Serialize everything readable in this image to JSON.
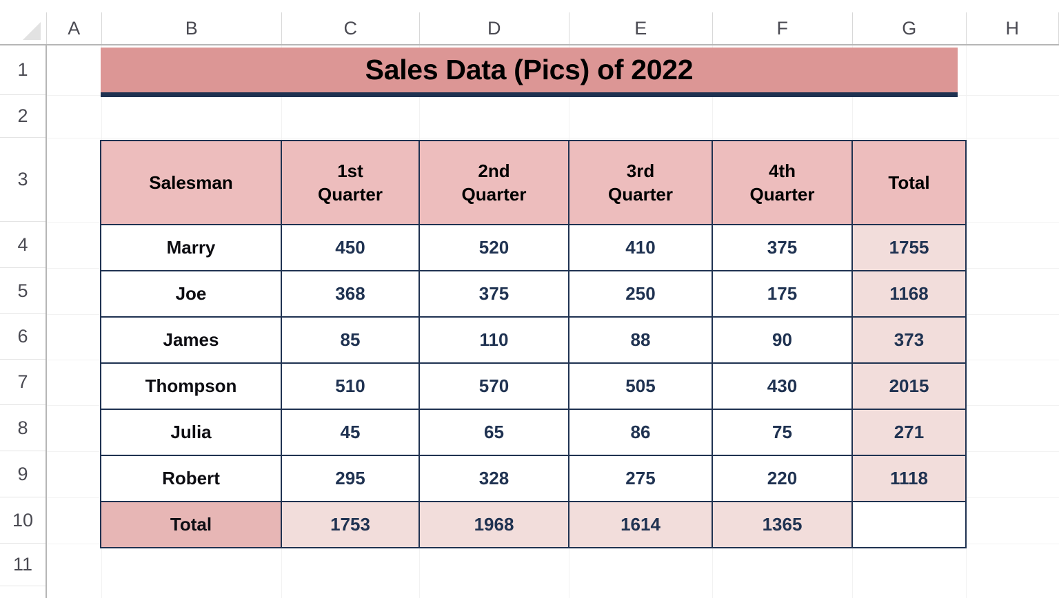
{
  "app": {
    "type": "spreadsheet",
    "colors": {
      "title_fill": "#DC9695",
      "title_underline": "#1F3251",
      "header_fill": "#EDBDBD",
      "total_column_fill": "#F2DDDB",
      "total_row_label_fill": "#E7B6B5",
      "border": "#1F3251",
      "data_text": "#1F3251",
      "gridline": "#F2F2F2",
      "header_strip_text": "#4A4A52"
    }
  },
  "column_headers": [
    "A",
    "B",
    "C",
    "D",
    "E",
    "F",
    "G",
    "H"
  ],
  "row_headers": [
    "1",
    "2",
    "3",
    "4",
    "5",
    "6",
    "7",
    "8",
    "9",
    "10",
    "11"
  ],
  "corner": {
    "icon": "select-all-triangle-icon"
  },
  "title": {
    "text": "Sales Data (Pics) of 2022",
    "merged_range": "B1:G1"
  },
  "table": {
    "headers": [
      {
        "lines": [
          "Salesman"
        ]
      },
      {
        "lines": [
          "1st",
          "Quarter"
        ]
      },
      {
        "lines": [
          "2nd",
          "Quarter"
        ]
      },
      {
        "lines": [
          "3rd",
          "Quarter"
        ]
      },
      {
        "lines": [
          "4th",
          "Quarter"
        ]
      },
      {
        "lines": [
          "Total"
        ]
      }
    ],
    "rows": [
      {
        "name": "Marry",
        "q1": "450",
        "q2": "520",
        "q3": "410",
        "q4": "375",
        "total": "1755"
      },
      {
        "name": "Joe",
        "q1": "368",
        "q2": "375",
        "q3": "250",
        "q4": "175",
        "total": "1168"
      },
      {
        "name": "James",
        "q1": "85",
        "q2": "110",
        "q3": "88",
        "q4": "90",
        "total": "373"
      },
      {
        "name": "Thompson",
        "q1": "510",
        "q2": "570",
        "q3": "505",
        "q4": "430",
        "total": "2015"
      },
      {
        "name": "Julia",
        "q1": "45",
        "q2": "65",
        "q3": "86",
        "q4": "75",
        "total": "271"
      },
      {
        "name": "Robert",
        "q1": "295",
        "q2": "328",
        "q3": "275",
        "q4": "220",
        "total": "1118"
      }
    ],
    "total_row": {
      "label": "Total",
      "q1": "1753",
      "q2": "1968",
      "q3": "1614",
      "q4": "1365",
      "total": ""
    }
  }
}
